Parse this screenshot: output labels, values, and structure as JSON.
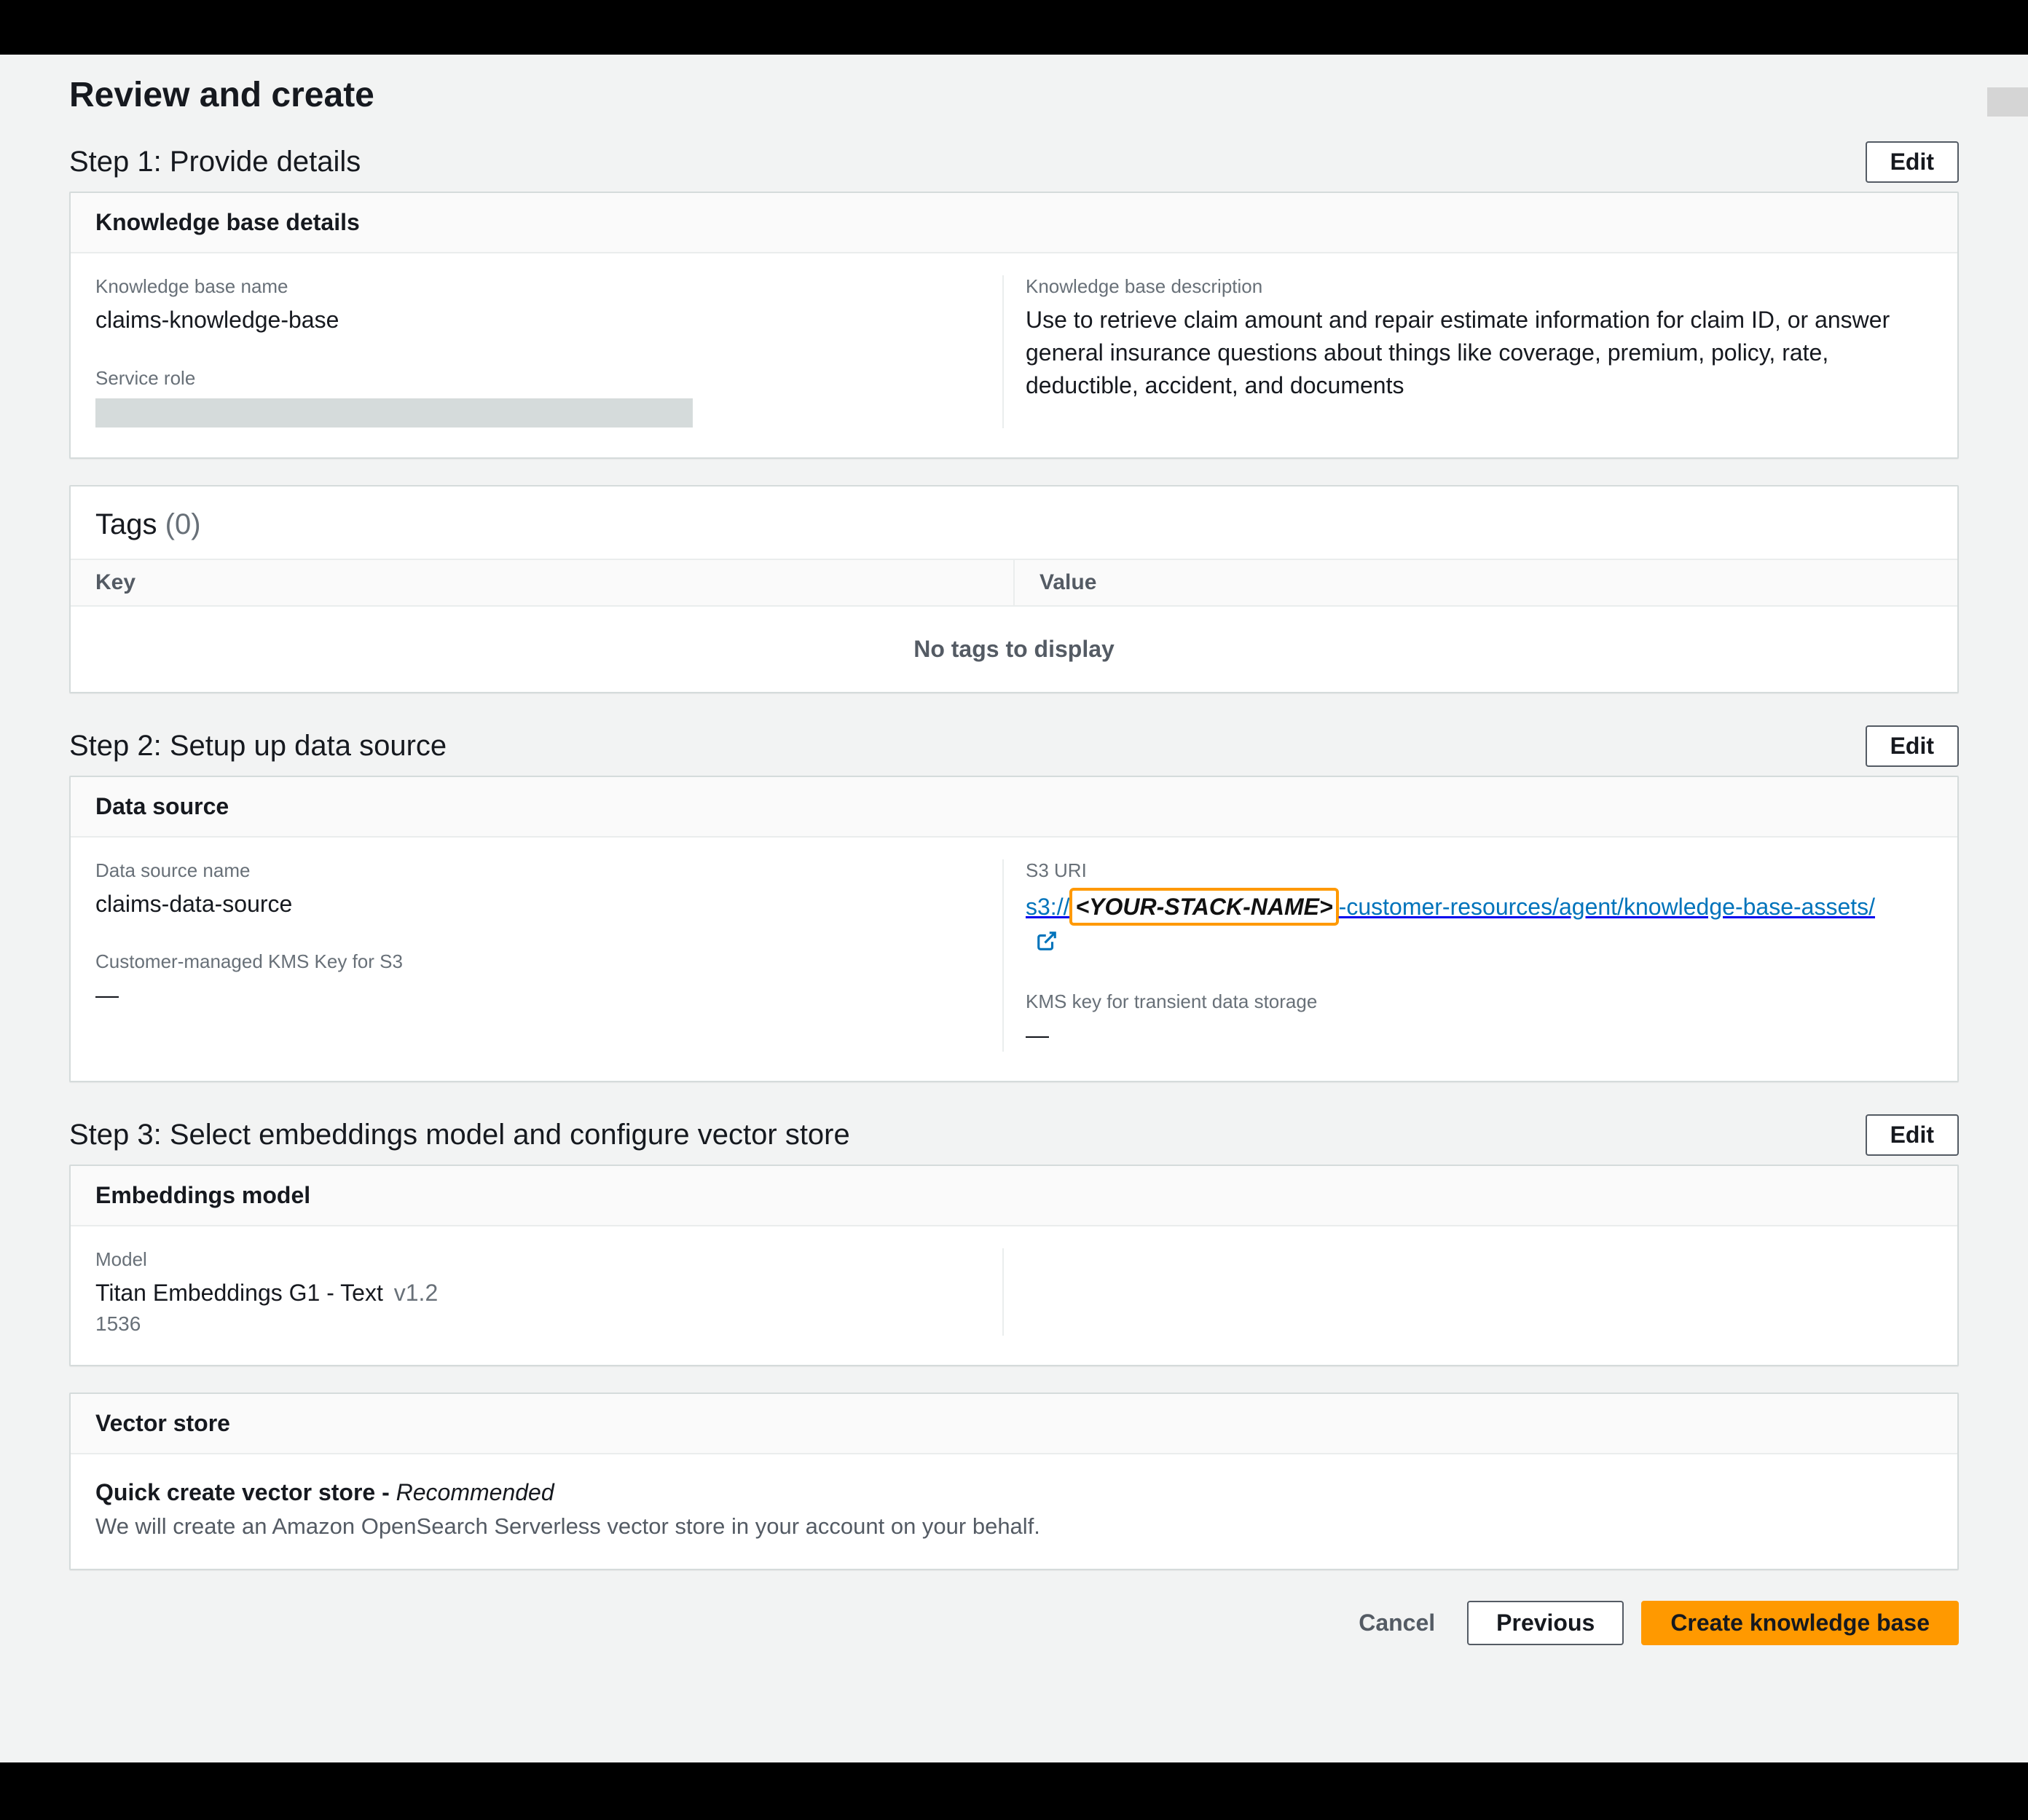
{
  "page_title": "Review and create",
  "edit_label": "Edit",
  "step1": {
    "title": "Step 1: Provide details",
    "panel_title": "Knowledge base details",
    "name_label": "Knowledge base name",
    "name_value": "claims-knowledge-base",
    "desc_label": "Knowledge base description",
    "desc_value": "Use to retrieve claim amount and repair estimate information for claim ID, or answer general insurance questions about things like coverage, premium, policy, rate, deductible, accident, and documents",
    "role_label": "Service role"
  },
  "tags": {
    "title": "Tags",
    "count": "(0)",
    "key_header": "Key",
    "value_header": "Value",
    "empty": "No tags to display"
  },
  "step2": {
    "title": "Step 2: Setup up data source",
    "panel_title": "Data source",
    "name_label": "Data source name",
    "name_value": "claims-data-source",
    "kms_s3_label": "Customer-managed KMS Key for S3",
    "kms_s3_value": "—",
    "s3_label": "S3 URI",
    "s3_prefix": "s3://",
    "s3_highlight": "<YOUR-STACK-NAME>",
    "s3_rest": "-customer-resources/agent/knowledge-base-assets/",
    "kms_transient_label": "KMS key for transient data storage",
    "kms_transient_value": "—"
  },
  "step3": {
    "title": "Step 3: Select embeddings model and configure vector store",
    "emb_panel_title": "Embeddings model",
    "model_label": "Model",
    "model_name": "Titan Embeddings G1 - Text",
    "model_version": "v1.2",
    "model_dim": "1536",
    "vs_panel_title": "Vector store",
    "vs_title_prefix": "Quick create vector store - ",
    "vs_title_suffix": "Recommended",
    "vs_desc": "We will create an Amazon OpenSearch Serverless vector store in your account on your behalf."
  },
  "footer": {
    "cancel": "Cancel",
    "previous": "Previous",
    "create": "Create knowledge base"
  }
}
